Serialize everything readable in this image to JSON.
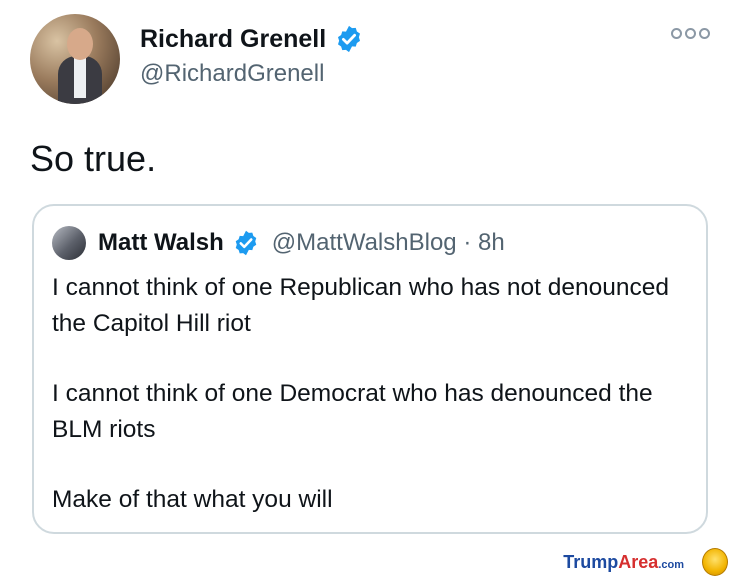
{
  "tweet": {
    "author_name": "Richard Grenell",
    "author_handle": "@RichardGrenell",
    "text": "So true.",
    "verified_icon": "verified-badge-icon",
    "more_icon": "more-options-icon"
  },
  "quoted_tweet": {
    "author_name": "Matt Walsh",
    "author_handle": "@MattWalshBlog",
    "separator": " · ",
    "time": "8h",
    "paragraphs": [
      "I cannot think of one Republican who has not denounced the Capitol Hill riot",
      "I cannot think of one Democrat who has denounced the BLM riots",
      "Make of that what you will"
    ]
  },
  "watermark": {
    "brand_main": "Trump",
    "brand_accent": "Area",
    "brand_suffix": ".com"
  },
  "colors": {
    "verified": "#1d9bf0",
    "secondary_text": "#536471",
    "border": "#cfd9de"
  }
}
